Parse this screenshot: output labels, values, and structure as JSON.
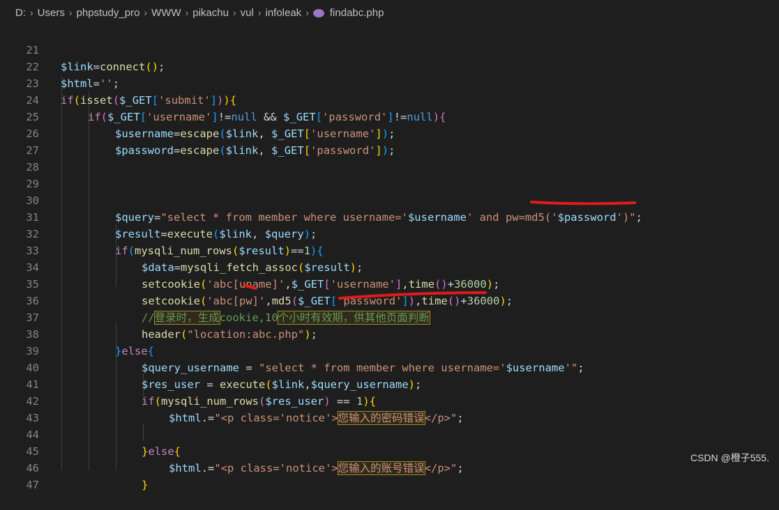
{
  "breadcrumb": {
    "items": [
      "D:",
      "Users",
      "phpstudy_pro",
      "WWW",
      "pikachu",
      "vul",
      "infoleak"
    ],
    "file": "findabc.php"
  },
  "lines": [
    {
      "no": "21"
    },
    {
      "no": "22"
    },
    {
      "no": "23"
    },
    {
      "no": "24"
    },
    {
      "no": "25"
    },
    {
      "no": "26"
    },
    {
      "no": "27"
    },
    {
      "no": "28"
    },
    {
      "no": "29"
    },
    {
      "no": "30"
    },
    {
      "no": "31"
    },
    {
      "no": "32"
    },
    {
      "no": "33"
    },
    {
      "no": "34"
    },
    {
      "no": "35"
    },
    {
      "no": "36"
    },
    {
      "no": "37"
    },
    {
      "no": "38"
    },
    {
      "no": "39"
    },
    {
      "no": "40"
    },
    {
      "no": "41"
    },
    {
      "no": "42"
    },
    {
      "no": "43"
    },
    {
      "no": "44"
    },
    {
      "no": "45"
    },
    {
      "no": "46"
    },
    {
      "no": "47"
    }
  ],
  "code": {
    "l21": [
      "$link",
      "=",
      "connect",
      "(",
      ")",
      ";"
    ],
    "l22": [
      "$html",
      "=",
      "''",
      ";"
    ],
    "l23": [
      "if",
      "(",
      "isset",
      "(",
      "$_GET",
      "[",
      "'submit'",
      "]",
      ")",
      ")",
      "{"
    ],
    "l24": [
      "if",
      "(",
      "$_GET",
      "[",
      "'username'",
      "]",
      "!=",
      "null",
      " && ",
      "$_GET",
      "[",
      "'password'",
      "]",
      "!=",
      "null",
      ")",
      "{"
    ],
    "l25": [
      "$username",
      "=",
      "escape",
      "(",
      "$link",
      ", ",
      "$_GET",
      "[",
      "'username'",
      "]",
      ")",
      ";"
    ],
    "l26": [
      "$password",
      "=",
      "escape",
      "(",
      "$link",
      ", ",
      "$_GET",
      "[",
      "'password'",
      "]",
      ")",
      ";"
    ],
    "l30": [
      "$query",
      "=",
      "\"select * from member where username='",
      "$username",
      "' and pw=md5('",
      "$password",
      "')\"",
      ";"
    ],
    "l31": [
      "$result",
      "=",
      "execute",
      "(",
      "$link",
      ", ",
      "$query",
      ")",
      ";"
    ],
    "l32": [
      "if",
      "(",
      "mysqli_num_rows",
      "(",
      "$result",
      ")",
      "==",
      "1",
      ")",
      "{"
    ],
    "l33": [
      "$data",
      "=",
      "mysqli_fetch_assoc",
      "(",
      "$result",
      ")",
      ";"
    ],
    "l34": [
      "setcookie",
      "(",
      "'abc[uname]'",
      ",",
      "$_GET",
      "[",
      "'username'",
      "]",
      ",",
      "time",
      "(",
      ")",
      "+",
      "36000",
      ")",
      ";"
    ],
    "l35": [
      "setcookie",
      "(",
      "'abc[pw]'",
      ",",
      "md5",
      "(",
      "$_GET",
      "[",
      "'password'",
      "]",
      ")",
      ",",
      "time",
      "(",
      ")",
      "+",
      "36000",
      ")",
      ";"
    ],
    "l36": [
      "//",
      "登录时，生成",
      "cookie,10",
      "个小时有效期，供其他页面判断"
    ],
    "l37": [
      "header",
      "(",
      "\"location:abc.php\"",
      ")",
      ";"
    ],
    "l38": [
      "}",
      "else",
      "{"
    ],
    "l39": [
      "$query_username",
      " = ",
      "\"select * from member where username='",
      "$username",
      "'\"",
      ";"
    ],
    "l40": [
      "$res_user",
      " = ",
      "execute",
      "(",
      "$link",
      ",",
      "$query_username",
      ")",
      ";"
    ],
    "l41": [
      "if",
      "(",
      "mysqli_num_rows",
      "(",
      "$res_user",
      ")",
      " == ",
      "1",
      ")",
      "{"
    ],
    "l42": [
      "$html",
      ".=",
      "\"<p class='notice'>",
      "您输入的密码错误",
      "</p>\"",
      ";"
    ],
    "l44": [
      "}",
      "else",
      "{"
    ],
    "l45": [
      "$html",
      ".=",
      "\"<p class='notice'>",
      "您输入的账号错误",
      "</p>\"",
      ";"
    ],
    "l46": [
      "}"
    ]
  },
  "watermark": "CSDN @橙子555.",
  "colors": {
    "background": "#1e1e1e",
    "variable": "#9cdcfe",
    "function": "#dcdcaa",
    "keyword": "#c586c0",
    "string": "#ce9178",
    "number": "#b5cea8",
    "comment": "#6a9955",
    "annotation_red": "#e01b1b"
  }
}
